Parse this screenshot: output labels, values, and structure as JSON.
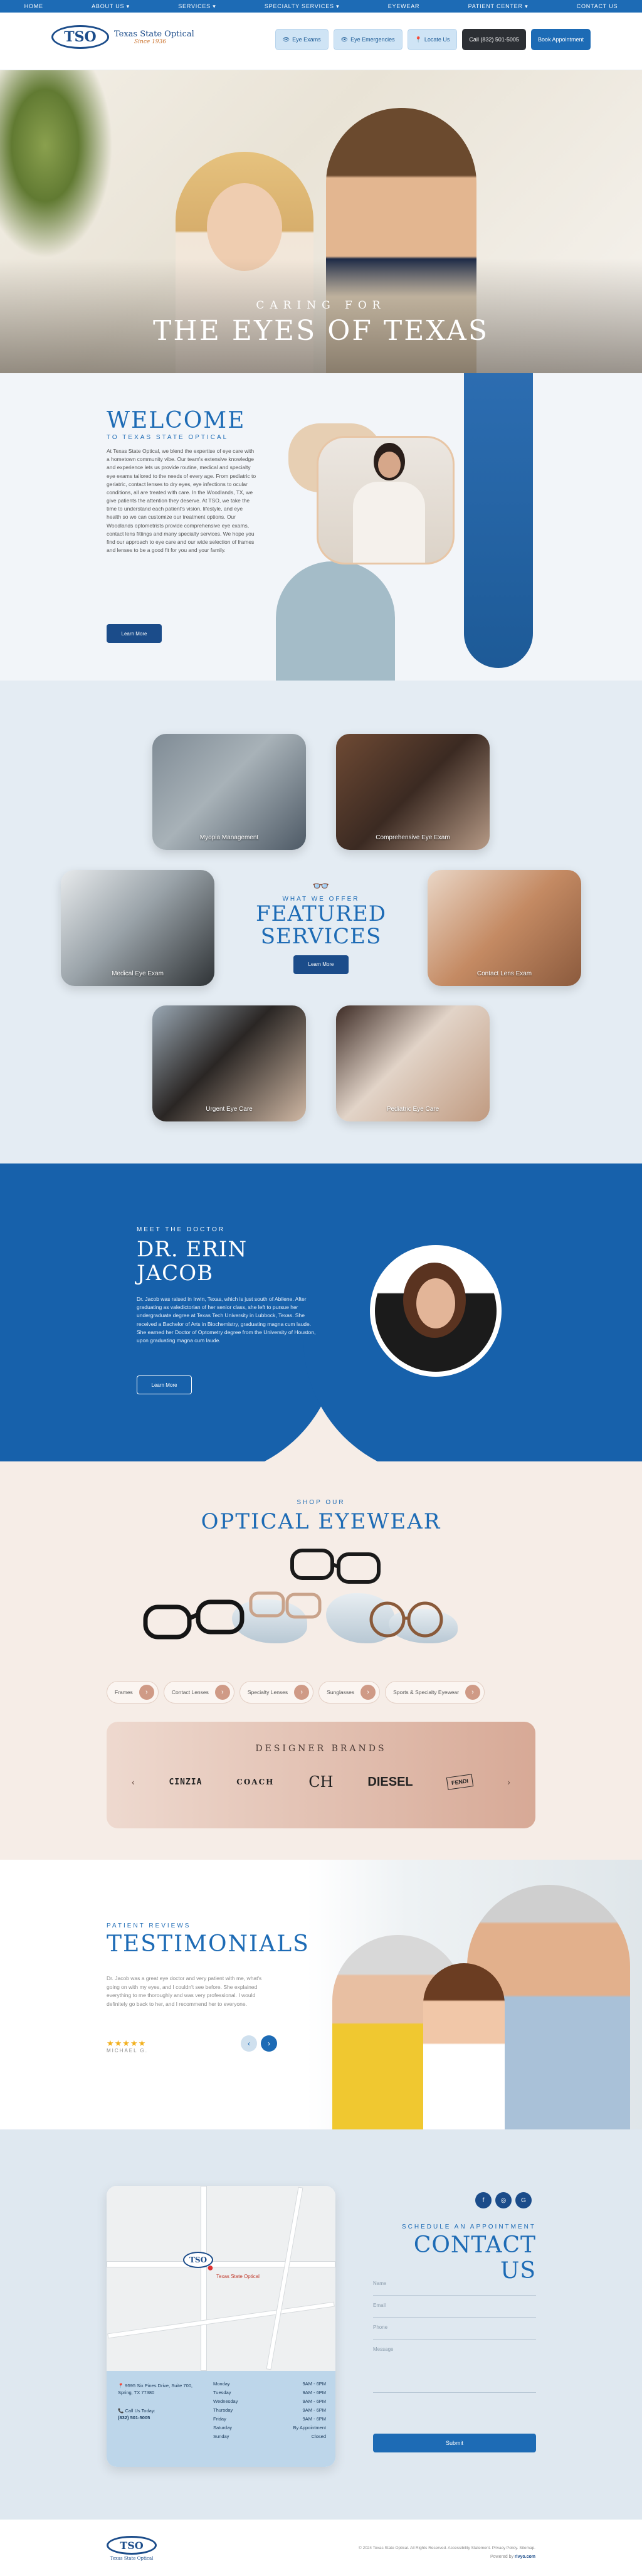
{
  "topnav": [
    "HOME",
    "ABOUT US ▾",
    "SERVICES ▾",
    "SPECIALTY SERVICES ▾",
    "EYEWEAR",
    "PATIENT CENTER ▾",
    "CONTACT US"
  ],
  "header": {
    "logo_mark": "TSO",
    "logo_name": "Texas State Optical",
    "logo_since": "Since 1936",
    "buttons": [
      "Eye Exams",
      "Eye Emergencies",
      "Locate Us",
      "Call (832) 501-5005",
      "Book Appointment"
    ]
  },
  "hero": {
    "subtitle": "CARING FOR",
    "title": "THE EYES OF TEXAS"
  },
  "welcome": {
    "title": "WELCOME",
    "eyebrow": "TO TEXAS STATE OPTICAL",
    "body": "At Texas State Optical, we blend the expertise of eye care with a hometown community vibe. Our team's extensive knowledge and experience lets us provide routine, medical and specialty eye exams tailored to the needs of every age. From pediatric to geriatric, contact lenses to dry eyes, eye infections to ocular conditions, all are treated with care. In the Woodlands, TX, we give patients the attention they deserve. At TSO, we take the time to understand each patient's vision, lifestyle, and eye health so we can customize our treatment options. Our Woodlands optometrists provide comprehensive eye exams, contact lens fittings and many specialty services. We hope you find our approach to eye care and our wide selection of frames and lenses to be a good fit for you and your family.",
    "button": "Learn More"
  },
  "services": {
    "eyebrow": "WHAT WE OFFER",
    "title_line1": "FEATURED",
    "title_line2": "SERVICES",
    "button": "Learn More",
    "cards": [
      "Myopia Management",
      "Comprehensive Eye Exam",
      "Medical Eye Exam",
      "Contact Lens Exam",
      "Urgent Eye Care",
      "Pediatric Eye Care"
    ]
  },
  "doctor": {
    "eyebrow": "MEET THE DOCTOR",
    "title_line1": "DR. ERIN",
    "title_line2": "JACOB",
    "body": "Dr. Jacob was raised in Irwin, Texas, which is just south of Abilene. After graduating as valedictorian of her senior class, she left to pursue her undergraduate degree at Texas Tech University in Lubbock, Texas. She received a Bachelor of Arts in Biochemistry, graduating magna cum laude. She earned her Doctor of Optometry degree from the University of Houston, upon graduating magna cum laude.",
    "button": "Learn More"
  },
  "eyewear": {
    "eyebrow": "SHOP OUR",
    "title": "OPTICAL EYEWEAR",
    "categories": [
      "Frames",
      "Contact Lenses",
      "Specialty Lenses",
      "Sunglasses",
      "Sports & Specialty Eyewear"
    ],
    "brands_title": "DESIGNER BRANDS",
    "brands": [
      "CINZIA",
      "COACH",
      "CH",
      "DIESEL",
      "FENDI"
    ]
  },
  "testimonials": {
    "eyebrow": "PATIENT REVIEWS",
    "title": "TESTIMONIALS",
    "quote": "Dr. Jacob was a great eye doctor and very patient with me, what's going on with my eyes, and I couldn't see before. She explained everything to me thoroughly and was very professional. I would definitely go back to her, and I recommend her to everyone.",
    "stars": "★★★★★",
    "author": "MICHAEL G."
  },
  "contact": {
    "eyebrow": "SCHEDULE AN APPOINTMENT",
    "title": "CONTACT US",
    "fields": [
      "Name",
      "Email",
      "Phone",
      "Message"
    ],
    "submit": "Submit",
    "address": "9595 Six Pines Drive, Suite 700, Spring, TX 77380",
    "phone_label": "Call Us Today:",
    "phone": "(832) 501-5005",
    "hours": [
      [
        "Monday",
        "9AM - 6PM"
      ],
      [
        "Tuesday",
        "9AM - 6PM"
      ],
      [
        "Wednesday",
        "9AM - 6PM"
      ],
      [
        "Thursday",
        "9AM - 6PM"
      ],
      [
        "Friday",
        "9AM - 6PM"
      ],
      [
        "Saturday",
        "By Appointment"
      ],
      [
        "Sunday",
        "Closed"
      ]
    ],
    "map_label": "Texas State Optical"
  },
  "footer": {
    "logo_mark": "TSO",
    "logo_name": "Texas State Optical",
    "copyright": "© 2024 Texas State Optical. All Rights Reserved. Accessibility Statement. Privacy Policy. Sitemap.",
    "powered_label": "Powered by",
    "powered_brand": "rivyo.com"
  },
  "colors": {
    "brand_blue": "#1d6bb5",
    "navy": "#1b4c8a",
    "peach": "#f6ede7"
  }
}
